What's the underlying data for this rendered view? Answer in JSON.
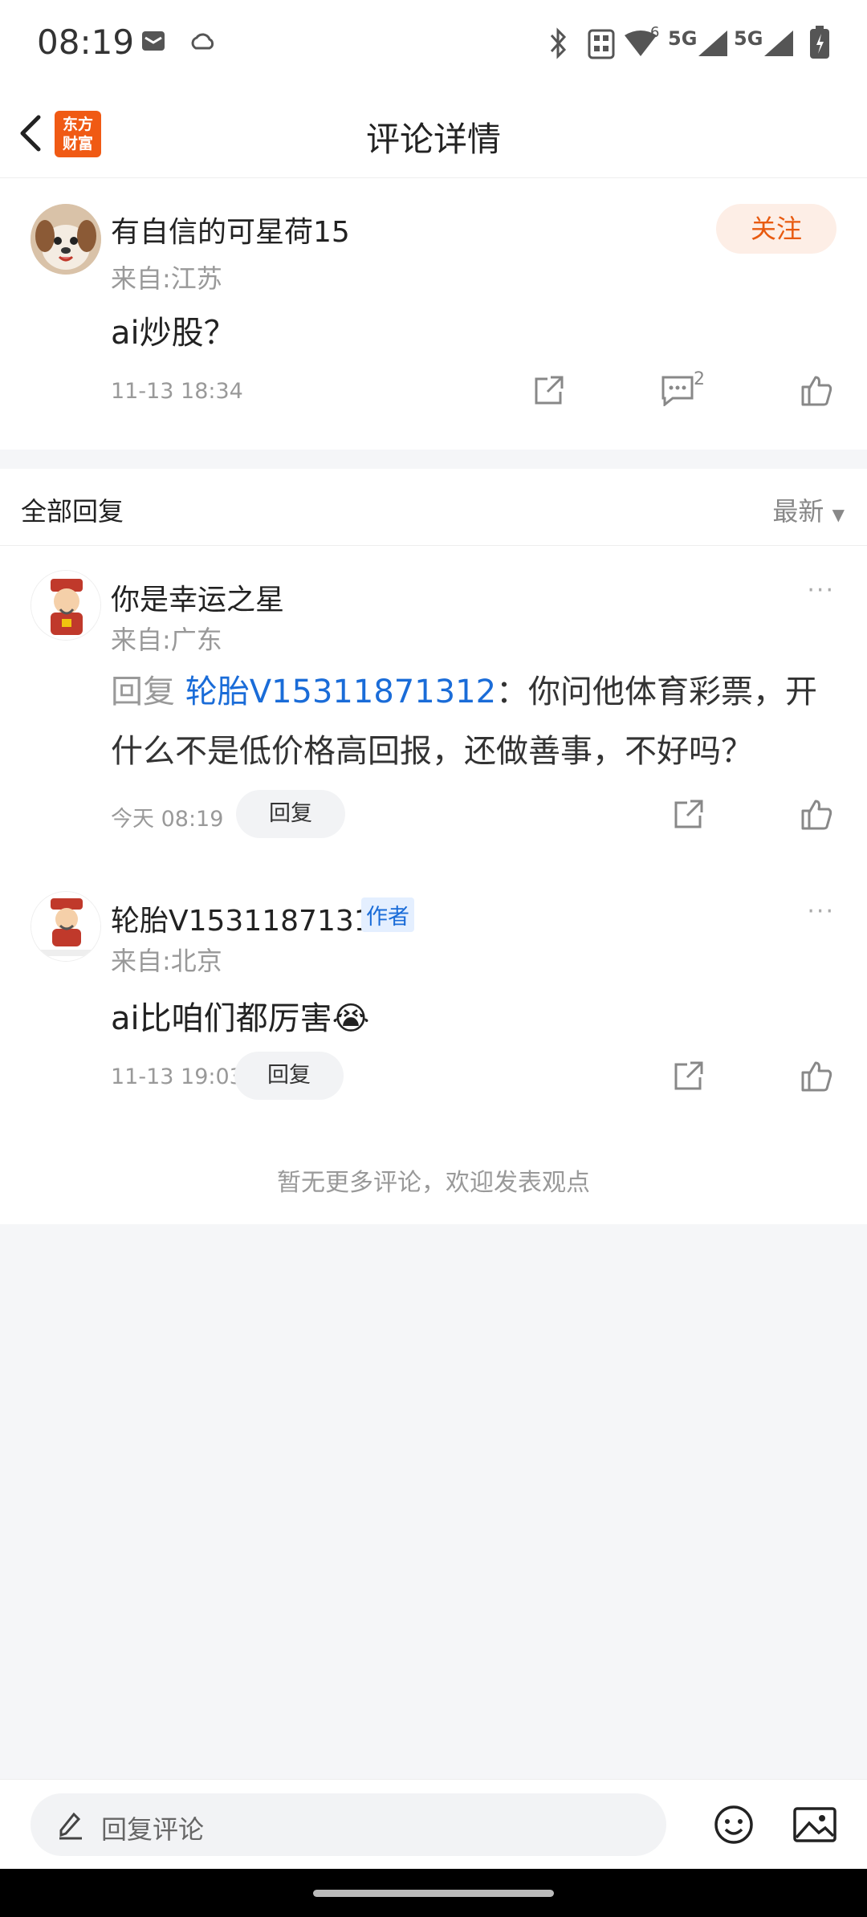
{
  "status_bar": {
    "time": "08:19",
    "net1": "5G",
    "net2": "5G",
    "wifi_sub": "6"
  },
  "nav": {
    "title": "评论详情",
    "logo_text_1": "东方",
    "logo_text_2": "财富"
  },
  "main_comment": {
    "username": "有自信的可星荷15",
    "location": "来自:江苏",
    "follow_label": "关注",
    "content": "ai炒股？",
    "date": "11-13 18:34",
    "comment_count": "2"
  },
  "replies_header": {
    "title": "全部回复",
    "sort_label": "最新"
  },
  "replies": [
    {
      "username": "你是幸运之星",
      "location": "来自:广东",
      "prefix": "回复 ",
      "mention": "轮胎V15311871312",
      "text": "：你问他体育彩票，开什么不是低价格高回报，还做善事，不好吗？",
      "date": "今天 08:19",
      "reply_label": "回复",
      "more": "···"
    },
    {
      "username": "轮胎V15311871312",
      "badge": "作者",
      "location": "来自:北京",
      "text": "ai比咱们都厉害",
      "emoji": "😭",
      "date": "11-13 19:03",
      "reply_label": "回复",
      "more": "···"
    }
  ],
  "footer_note": "暂无更多评论，欢迎发表观点",
  "bottom_bar": {
    "placeholder": "回复评论"
  },
  "colors": {
    "accent": "#e85a10",
    "link": "#1a6cd8",
    "bg": "#f5f6f8"
  }
}
